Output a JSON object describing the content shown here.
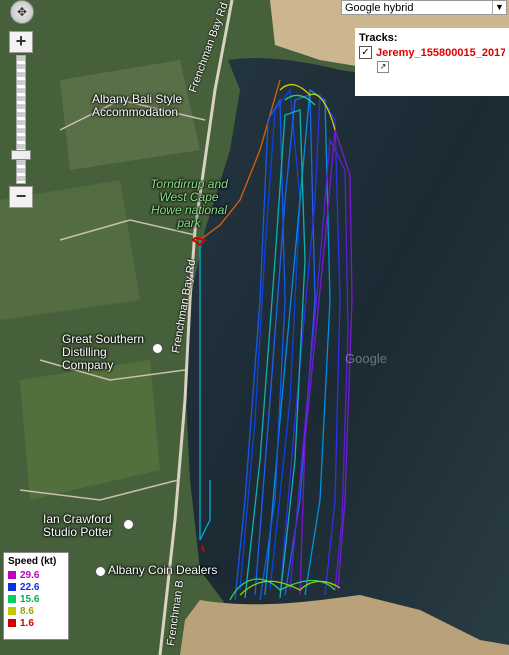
{
  "map": {
    "type_select": "Google hybrid",
    "watermark_text": "Google"
  },
  "tracks_panel": {
    "title": "Tracks:",
    "track_name": "Jeremy_155800015_2017"
  },
  "legend": {
    "title": "Speed (kt)",
    "items": [
      {
        "value": "29.6",
        "color": "#c000c0"
      },
      {
        "value": "22.6",
        "color": "#1030e0"
      },
      {
        "value": "15.6",
        "color": "#00d060"
      },
      {
        "value": "8.6",
        "color": "#c8c800"
      },
      {
        "value": "1.6",
        "color": "#d00000"
      }
    ]
  },
  "places": {
    "albany_bali": "Albany Bali Style Accommodation",
    "torndirrup": "Torndirrup and West Cape Howe national park",
    "great_southern": "Great Southern Distilling Company",
    "ian_crawford": "Ian Crawford Studio Potter",
    "albany_coin": "Albany Coin Dealers"
  },
  "roads": {
    "road1": "Frenchman Bay Rd",
    "road2": "Frenchman Bay Rd",
    "road3": "Frenchman B"
  }
}
